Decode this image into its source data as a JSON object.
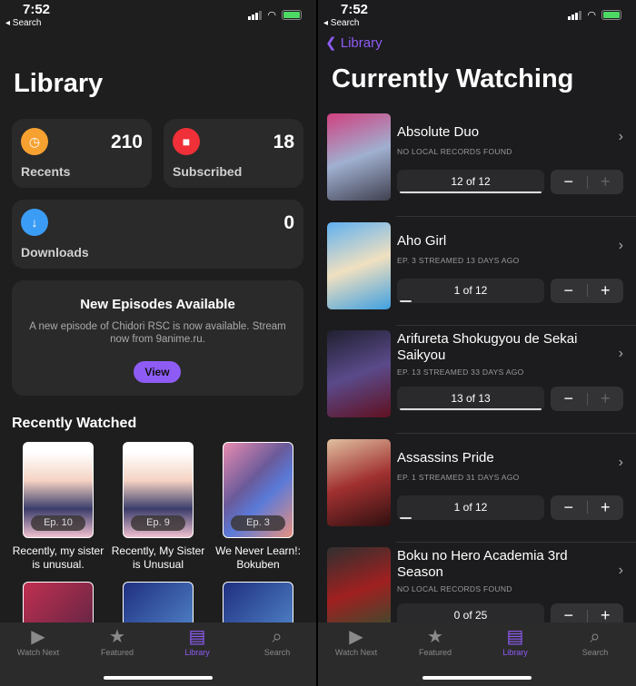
{
  "status": {
    "time": "7:52",
    "back_app": "◂ Search"
  },
  "left": {
    "title": "Library",
    "cards": [
      {
        "label": "Recents",
        "count": "210",
        "icon": "clock-icon",
        "color": "#f7a131"
      },
      {
        "label": "Subscribed",
        "count": "18",
        "icon": "subscription-badge-icon",
        "color": "#ef3038"
      },
      {
        "label": "Downloads",
        "count": "0",
        "icon": "download-icon",
        "color": "#3b9cf5"
      }
    ],
    "news": {
      "title": "New Episodes Available",
      "body": "A new episode of Chidori RSC is now available. Stream now from 9anime.ru.",
      "button": "View"
    },
    "section": "Recently Watched",
    "recent": [
      {
        "ep": "Ep. 10",
        "title": "Recently, my sister is unusual."
      },
      {
        "ep": "Ep. 9",
        "title": "Recently, My Sister is Unusual"
      },
      {
        "ep": "Ep. 3",
        "title": "We Never Learn!: Bokuben"
      }
    ]
  },
  "right": {
    "back": "Library",
    "title": "Currently Watching",
    "rows": [
      {
        "title": "Absolute Duo",
        "sub": "NO LOCAL RECORDS FOUND",
        "progress": "12 of 12",
        "fraction": 1,
        "plus_enabled": false
      },
      {
        "title": "Aho Girl",
        "sub": "EP. 3 STREAMED 13 DAYS AGO",
        "progress": "1 of 12",
        "fraction": 0.083,
        "plus_enabled": true
      },
      {
        "title": "Arifureta Shokugyou de Sekai Saikyou",
        "sub": "EP. 13 STREAMED 33 DAYS AGO",
        "progress": "13 of 13",
        "fraction": 1,
        "plus_enabled": false
      },
      {
        "title": "Assassins Pride",
        "sub": "EP. 1 STREAMED 31 DAYS AGO",
        "progress": "1 of 12",
        "fraction": 0.083,
        "plus_enabled": true
      },
      {
        "title": "Boku no Hero Academia 3rd Season",
        "sub": "NO LOCAL RECORDS FOUND",
        "progress": "0 of 25",
        "fraction": 0,
        "plus_enabled": true
      }
    ]
  },
  "tabs": [
    {
      "label": "Watch Next",
      "icon": "play-icon"
    },
    {
      "label": "Featured",
      "icon": "star-icon"
    },
    {
      "label": "Library",
      "icon": "library-icon",
      "active": true
    },
    {
      "label": "Search",
      "icon": "search-icon"
    }
  ],
  "accent": "#8e5cf5"
}
